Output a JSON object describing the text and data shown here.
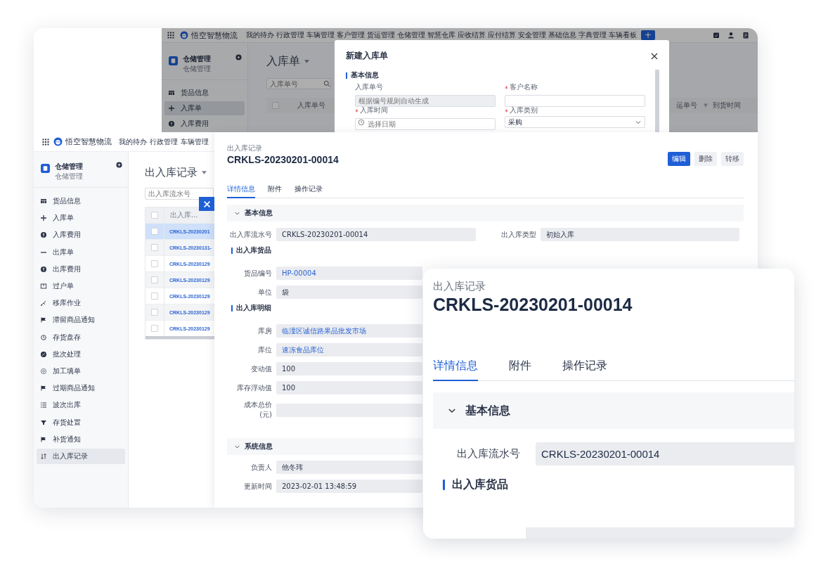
{
  "back_app": {
    "brand": "悟空智慧物流",
    "nav": [
      "我的待办",
      "行政管理",
      "车辆管理",
      "客户管理",
      "货运管理",
      "仓储管理",
      "智慧仓库",
      "应收结算",
      "应付结算",
      "安全管理",
      "基础信息",
      "字典管理",
      "车辆看板"
    ],
    "add_button": "+",
    "module": {
      "title": "仓储管理",
      "subtitle": "仓储管理"
    },
    "menu": [
      {
        "label": "货品信息",
        "selected": false
      },
      {
        "label": "入库单",
        "selected": true
      },
      {
        "label": "入库费用",
        "selected": false
      }
    ],
    "page_title": "入库单",
    "search": {
      "placeholder": "入库单号"
    },
    "columns": [
      "入库单号",
      "运单号",
      "到货时间"
    ],
    "header_checked": false,
    "dialog": {
      "title": "新建入库单",
      "section": "基本信息",
      "fields": [
        {
          "label": "入库单号",
          "required": false,
          "kind": "text",
          "placeholder": "根据编号规则自动生成",
          "disabled": true
        },
        {
          "label": "客户名称",
          "required": true,
          "kind": "text",
          "disabled": false
        },
        {
          "label": "入库时间",
          "required": true,
          "kind": "date",
          "placeholder": "选择日期",
          "disabled": false
        },
        {
          "label": "入库类别",
          "required": true,
          "kind": "select",
          "value": "采购",
          "disabled": false
        }
      ]
    }
  },
  "main_app": {
    "brand": "悟空智慧物流",
    "nav": [
      "我的待办",
      "行政管理",
      "车辆管理"
    ],
    "module": {
      "title": "仓储管理",
      "subtitle": "仓储管理"
    },
    "menu": [
      {
        "label": "货品信息",
        "selected": false
      },
      {
        "label": "入库单",
        "selected": false
      },
      {
        "label": "入库费用",
        "selected": false
      },
      {
        "label": "出库单",
        "selected": false
      },
      {
        "label": "出库费用",
        "selected": false
      },
      {
        "label": "过户单",
        "selected": false
      },
      {
        "label": "移库作业",
        "selected": false
      },
      {
        "label": "滞留商品通知",
        "selected": false
      },
      {
        "label": "存货盘存",
        "selected": false
      },
      {
        "label": "批次处理",
        "selected": false
      },
      {
        "label": "加工填单",
        "selected": false
      },
      {
        "label": "过期商品通知",
        "selected": false
      },
      {
        "label": "波次出库",
        "selected": false
      },
      {
        "label": "存货处置",
        "selected": false
      },
      {
        "label": "补货通知",
        "selected": false
      },
      {
        "label": "出入库记录",
        "selected": true
      }
    ],
    "page_title": "出入库记录",
    "search": {
      "placeholder": "出入库流水号"
    },
    "table": {
      "column": "出入库...",
      "header_checked": false,
      "rows": [
        {
          "serial": "CRKLS-20230201",
          "selected": true,
          "checked": false
        },
        {
          "serial": "CRKLS-20230131-",
          "selected": false,
          "checked": false
        },
        {
          "serial": "CRKLS-20230129",
          "selected": false,
          "checked": false
        },
        {
          "serial": "CRKLS-20230129",
          "selected": false,
          "checked": false
        },
        {
          "serial": "CRKLS-20230129",
          "selected": false,
          "checked": false
        },
        {
          "serial": "CRKLS-20230129",
          "selected": false,
          "checked": false
        },
        {
          "serial": "CRKLS-20230129",
          "selected": false,
          "checked": false
        }
      ]
    }
  },
  "detail": {
    "breadcrumb": "出入库记录",
    "title": "CRKLS-20230201-00014",
    "buttons": [
      {
        "label": "编辑",
        "kind": "primary"
      },
      {
        "label": "删除",
        "kind": "default"
      },
      {
        "label": "转移",
        "kind": "default"
      }
    ],
    "tabs": [
      {
        "label": "详情信息",
        "selected": true
      },
      {
        "label": "附件",
        "selected": false
      },
      {
        "label": "操作记录",
        "selected": false
      }
    ],
    "basic": {
      "title": "基本信息",
      "expanded": true,
      "fields": [
        {
          "label": "出入库流水号",
          "value": "CRKLS-20230201-00014"
        },
        {
          "label": "出入库类型",
          "value": "初始入库"
        }
      ],
      "subsections": [
        {
          "title": "出入库货品",
          "fields": [
            {
              "label": "货品编号",
              "value": "HP-00004",
              "link": true
            },
            {
              "label": "单位",
              "value": "袋",
              "link": false
            }
          ]
        },
        {
          "title": "出入库明细",
          "fields": [
            {
              "label": "库房",
              "value": "临潼区诚信路果品批发市场",
              "link": true
            },
            {
              "label": "库位",
              "value": "速冻食品库位",
              "link": true
            },
            {
              "label": "变动值",
              "value": "100",
              "link": false
            },
            {
              "label": "库存浮动值",
              "value": "100",
              "link": false
            },
            {
              "label": "成本总价\n(元)",
              "link": false
            }
          ]
        }
      ]
    },
    "system": {
      "title": "系统信息",
      "expanded": true,
      "fields": [
        {
          "label": "负责人",
          "value": "他冬玮",
          "link": false
        },
        {
          "label": "更新时间",
          "value": "2023-02-01 13:48:59",
          "link": false
        }
      ]
    }
  },
  "zoom_card": {
    "breadcrumb": "出入库记录",
    "title": "CRKLS-20230201-00014",
    "tabs": [
      {
        "label": "详情信息",
        "selected": true
      },
      {
        "label": "附件",
        "selected": false
      },
      {
        "label": "操作记录",
        "selected": false
      }
    ],
    "section": {
      "title": "基本信息",
      "expanded": true
    },
    "field": {
      "label": "出入库流水号",
      "value": "CRKLS-20230201-00014"
    },
    "subsection": "出入库货品"
  }
}
